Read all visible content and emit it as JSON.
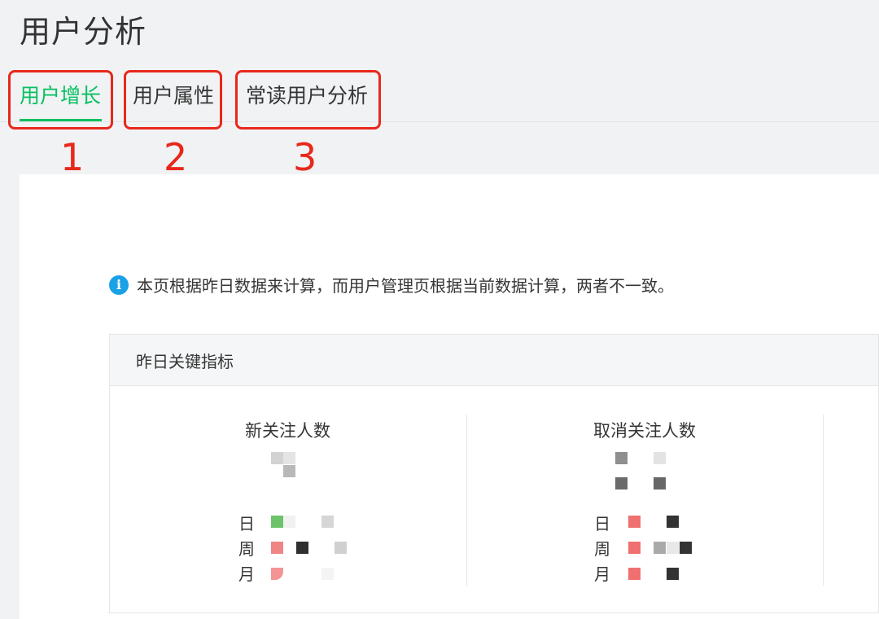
{
  "page": {
    "title": "用户分析"
  },
  "tabs": [
    {
      "label": "用户增长",
      "active": true
    },
    {
      "label": "用户属性",
      "active": false
    },
    {
      "label": "常读用户分析",
      "active": false
    }
  ],
  "annotations": [
    "1",
    "2",
    "3"
  ],
  "notice": {
    "icon": "info-icon",
    "text": "本页根据昨日数据来计算，而用户管理页根据当前数据计算，两者不一致。"
  },
  "metrics": {
    "header": "昨日关键指标",
    "cards": [
      {
        "title": "新关注人数",
        "periods": [
          "日",
          "周",
          "月"
        ]
      },
      {
        "title": "取消关注人数",
        "periods": [
          "日",
          "周",
          "月"
        ]
      }
    ]
  },
  "colors": {
    "accent": "#07c160",
    "annotation": "#e8281b",
    "info": "#1aa1e6"
  }
}
